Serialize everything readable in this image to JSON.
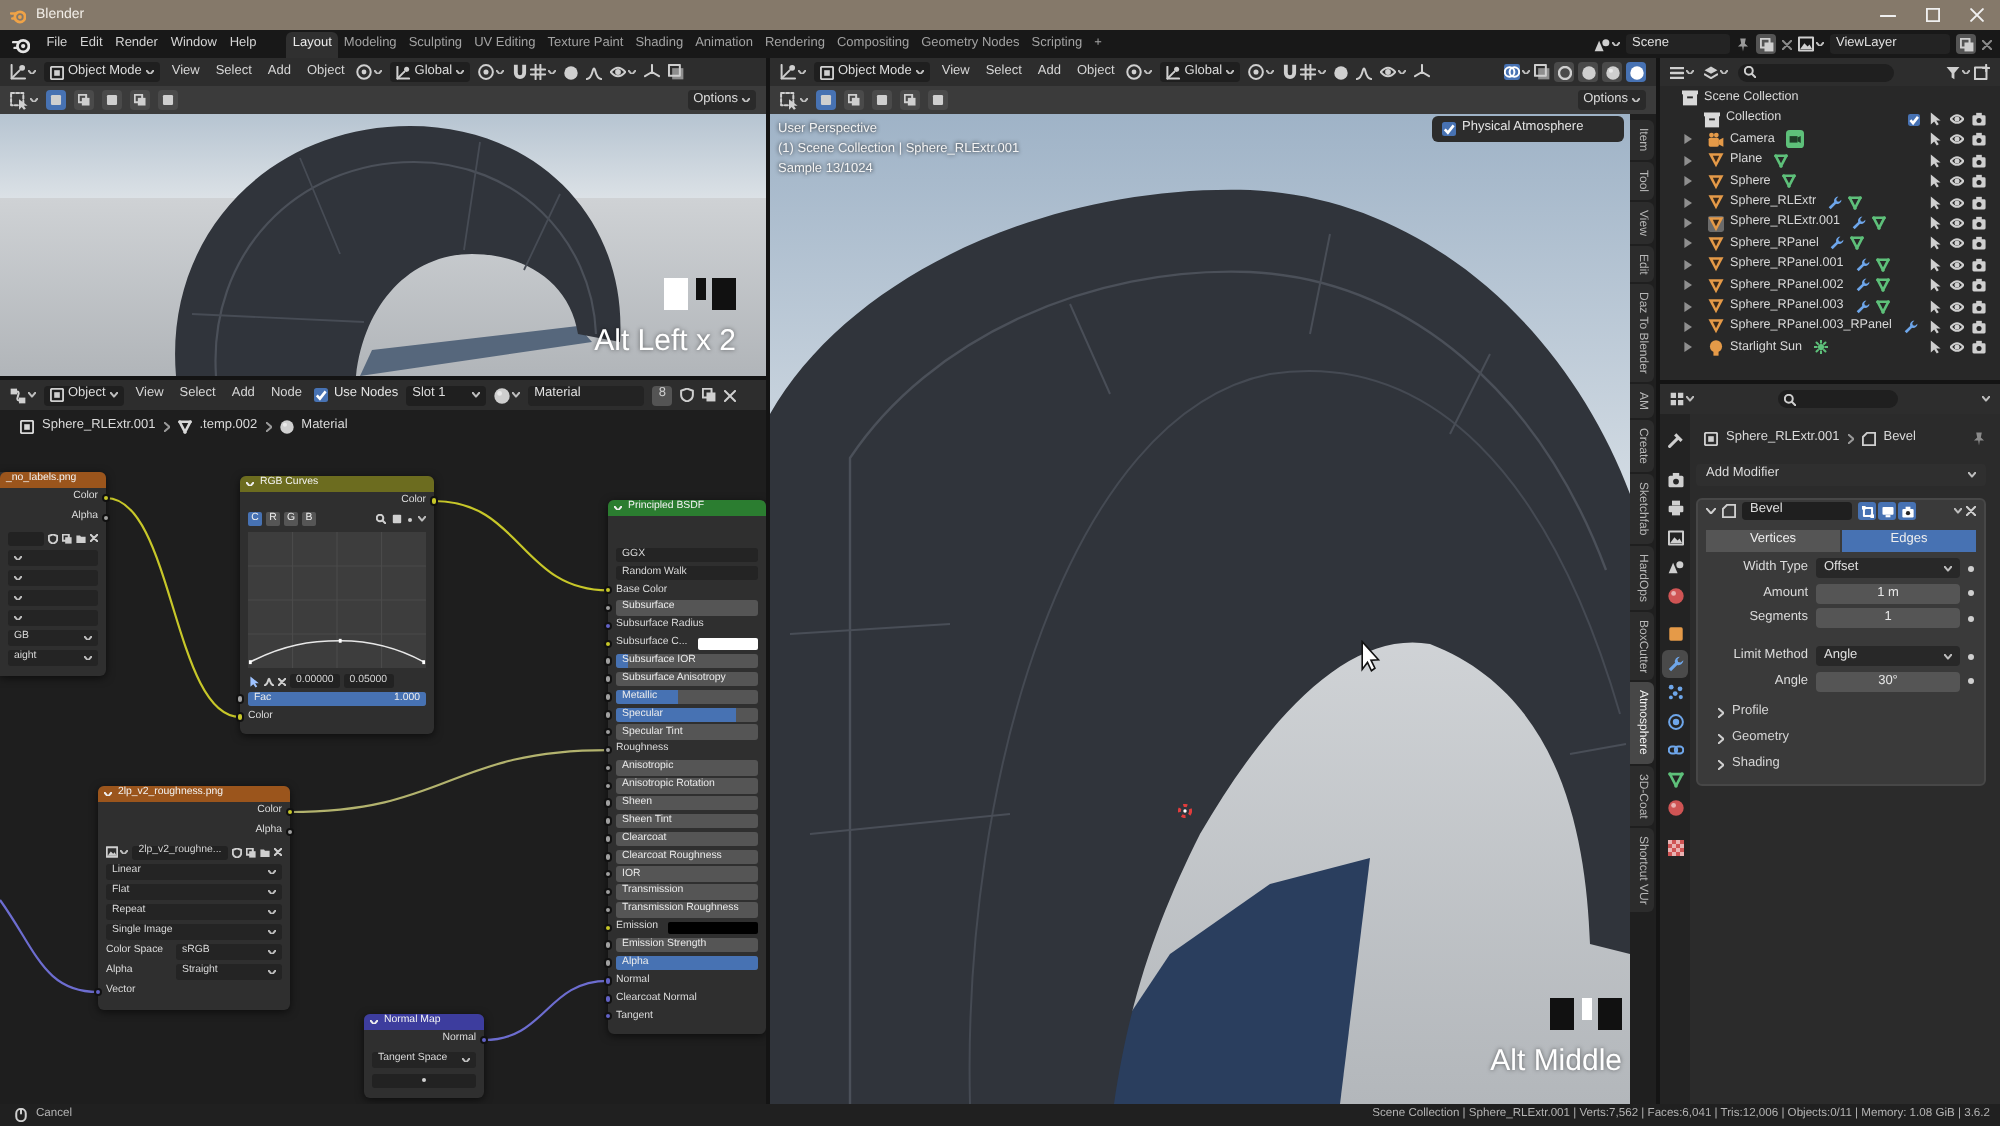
{
  "window": {
    "title": "Blender"
  },
  "topbar": {
    "menus": [
      "File",
      "Edit",
      "Render",
      "Window",
      "Help"
    ],
    "workspaces": [
      {
        "label": "Layout",
        "selected": true
      },
      {
        "label": "Modeling",
        "selected": false
      },
      {
        "label": "Sculpting",
        "selected": false
      },
      {
        "label": "UV Editing",
        "selected": false
      },
      {
        "label": "Texture Paint",
        "selected": false
      },
      {
        "label": "Shading",
        "selected": false
      },
      {
        "label": "Animation",
        "selected": false
      },
      {
        "label": "Rendering",
        "selected": false
      },
      {
        "label": "Compositing",
        "selected": false
      },
      {
        "label": "Geometry Nodes",
        "selected": false
      },
      {
        "label": "Scripting",
        "selected": false
      }
    ],
    "add_workspace": "+",
    "scene": "Scene",
    "view_layer": "ViewLayer"
  },
  "left_viewport": {
    "mode": "Object Mode",
    "menus": [
      "View",
      "Select",
      "Add",
      "Object"
    ],
    "orientation": "Global",
    "select_modes": [
      {
        "selected": true
      },
      {
        "selected": false
      },
      {
        "selected": false
      },
      {
        "selected": false
      },
      {
        "selected": false
      }
    ],
    "options": "Options",
    "key_overlay": {
      "text": "Alt Left x 2",
      "mouse_buttons": [
        {
          "pressed": true
        },
        {
          "pressed": false
        },
        {
          "pressed": false
        }
      ]
    }
  },
  "node_editor": {
    "mode": "Object",
    "menus": [
      "View",
      "Select",
      "Add",
      "Node"
    ],
    "use_nodes": {
      "label": "Use Nodes",
      "checked": true
    },
    "slot": "Slot 1",
    "material": "Material",
    "users": "8",
    "breadcrumb": [
      "Sphere_RLExtr.001",
      ".temp.002",
      "Material"
    ],
    "nodes": [
      {
        "kind": "image_texture",
        "title": "_no_labels.png",
        "color": "#9b551c",
        "rows": [
          {
            "kind": "output",
            "label": "Color",
            "socket": {
              "kind": "color"
            }
          },
          {
            "kind": "output",
            "label": "Alpha",
            "socket": {
              "kind": "float"
            }
          },
          {
            "kind": "image"
          },
          {
            "kind": "dropdown"
          },
          {
            "kind": "dropdown"
          },
          {
            "kind": "dropdown"
          },
          {
            "kind": "dropdown"
          },
          {
            "kind": "dropdown",
            "value": "GB"
          },
          {
            "kind": "dropdown",
            "value": "aight"
          }
        ]
      },
      {
        "kind": "rgb_curves",
        "title": "RGB Curves",
        "color": "#6c6c1f",
        "rows": [
          {
            "kind": "output",
            "label": "Color",
            "socket": {
              "kind": "color"
            }
          },
          {
            "kind": "curve_buttons",
            "buttons": [
              {
                "label": "C",
                "selected": true
              },
              {
                "label": "R",
                "selected": false
              },
              {
                "label": "G",
                "selected": false
              },
              {
                "label": "B",
                "selected": false
              }
            ]
          },
          {
            "kind": "curve"
          },
          {
            "kind": "curve_tools",
            "values": [
              "0.00000",
              "0.05000"
            ]
          },
          {
            "kind": "slider",
            "label": "Fac",
            "value": "1.000",
            "level": 1,
            "socket": {
              "kind": "float"
            }
          },
          {
            "kind": "input",
            "label": "Color",
            "socket": {
              "kind": "color"
            }
          }
        ]
      },
      {
        "kind": "principled",
        "title": "Principled BSDF",
        "color": "#2b7d30",
        "rows": [
          {
            "kind": "dropdown",
            "value": "GGX"
          },
          {
            "kind": "dropdown",
            "value": "Random Walk"
          },
          {
            "kind": "input",
            "label": "Base Color",
            "socket": {
              "kind": "color"
            }
          },
          {
            "kind": "slider",
            "label": "Subsurface",
            "level": 0,
            "socket": {
              "kind": "float"
            }
          },
          {
            "kind": "input",
            "label": "Subsurface Radius",
            "socket": {
              "kind": "vector"
            }
          },
          {
            "kind": "color",
            "label": "Subsurface C...",
            "color": "#ffffff",
            "socket": {
              "kind": "color"
            }
          },
          {
            "kind": "slider",
            "label": "Subsurface IOR",
            "level": 0.09,
            "socket": {
              "kind": "float"
            }
          },
          {
            "kind": "slider",
            "label": "Subsurface Anisotropy",
            "level": 0,
            "socket": {
              "kind": "float"
            }
          },
          {
            "kind": "slider",
            "label": "Metallic",
            "level": 0.43,
            "socket": {
              "kind": "float"
            }
          },
          {
            "kind": "slider",
            "label": "Specular",
            "level": 0.84,
            "socket": {
              "kind": "float"
            }
          },
          {
            "kind": "slider",
            "label": "Specular Tint",
            "level": 0,
            "socket": {
              "kind": "float"
            }
          },
          {
            "kind": "input",
            "label": "Roughness",
            "socket": {
              "kind": "float"
            }
          },
          {
            "kind": "slider",
            "label": "Anisotropic",
            "level": 0,
            "socket": {
              "kind": "float"
            }
          },
          {
            "kind": "slider",
            "label": "Anisotropic Rotation",
            "level": 0,
            "socket": {
              "kind": "float"
            }
          },
          {
            "kind": "slider",
            "label": "Sheen",
            "level": 0,
            "socket": {
              "kind": "float"
            }
          },
          {
            "kind": "slider",
            "label": "Sheen Tint",
            "level": 0,
            "socket": {
              "kind": "float"
            }
          },
          {
            "kind": "slider",
            "label": "Clearcoat",
            "level": 0,
            "socket": {
              "kind": "float"
            }
          },
          {
            "kind": "slider",
            "label": "Clearcoat Roughness",
            "level": 0,
            "socket": {
              "kind": "float"
            }
          },
          {
            "kind": "slider",
            "label": "IOR",
            "level": 0,
            "socket": {
              "kind": "float"
            }
          },
          {
            "kind": "slider",
            "label": "Transmission",
            "level": 0,
            "socket": {
              "kind": "float"
            }
          },
          {
            "kind": "slider",
            "label": "Transmission Roughness",
            "level": 0,
            "socket": {
              "kind": "float"
            }
          },
          {
            "kind": "color",
            "label": "Emission",
            "color": "#000000",
            "socket": {
              "kind": "color"
            }
          },
          {
            "kind": "slider",
            "label": "Emission Strength",
            "level": 0,
            "socket": {
              "kind": "float"
            }
          },
          {
            "kind": "slider",
            "label": "Alpha",
            "level": 1,
            "socket": {
              "kind": "float"
            }
          },
          {
            "kind": "input",
            "label": "Normal",
            "socket": {
              "kind": "vector"
            }
          },
          {
            "kind": "input",
            "label": "Clearcoat Normal",
            "socket": {
              "kind": "vector"
            }
          },
          {
            "kind": "input",
            "label": "Tangent",
            "socket": {
              "kind": "vector"
            }
          }
        ]
      },
      {
        "kind": "image_texture",
        "title": "2lp_v2_roughness.png",
        "color": "#9b551c",
        "rows": [
          {
            "kind": "output",
            "label": "Color",
            "socket": {
              "kind": "color"
            }
          },
          {
            "kind": "output",
            "label": "Alpha",
            "socket": {
              "kind": "float"
            }
          },
          {
            "kind": "image",
            "value": "2lp_v2_roughne..."
          },
          {
            "kind": "dropdown",
            "value": "Linear"
          },
          {
            "kind": "dropdown",
            "value": "Flat"
          },
          {
            "kind": "dropdown",
            "value": "Repeat"
          },
          {
            "kind": "dropdown",
            "value": "Single Image"
          },
          {
            "kind": "dropdown",
            "label": "Color Space",
            "value": "sRGB"
          },
          {
            "kind": "dropdown",
            "label": "Alpha",
            "value": "Straight"
          },
          {
            "kind": "input",
            "label": "Vector",
            "socket": {
              "kind": "vector"
            }
          }
        ]
      },
      {
        "kind": "normal_map",
        "title": "Normal Map",
        "color": "#3d3d9e",
        "rows": [
          {
            "kind": "output",
            "label": "Normal",
            "socket": {
              "kind": "vector"
            }
          },
          {
            "kind": "dropdown",
            "value": "Tangent Space"
          },
          {
            "kind": "field"
          }
        ]
      }
    ]
  },
  "main_viewport": {
    "mode": "Object Mode",
    "menus": [
      "View",
      "Select",
      "Add",
      "Object"
    ],
    "orientation": "Global",
    "shading_modes": [
      {
        "selected": false
      },
      {
        "selected": false
      },
      {
        "selected": false
      },
      {
        "selected": true
      }
    ],
    "select_modes": [
      {
        "selected": true
      },
      {
        "selected": false
      },
      {
        "selected": false
      },
      {
        "selected": false
      },
      {
        "selected": false
      }
    ],
    "options": "Options",
    "info": [
      "User Perspective",
      "(1) Scene Collection | Sphere_RLExtr.001",
      "Sample 13/1024"
    ],
    "physical_atmosphere": {
      "label": "Physical Atmosphere",
      "checked": true
    },
    "key_overlay": {
      "text": "Alt Middle",
      "mouse_buttons": [
        {
          "pressed": false
        },
        {
          "pressed": true
        },
        {
          "pressed": false
        }
      ]
    },
    "sidebar_tabs": [
      {
        "label": "Item",
        "selected": false
      },
      {
        "label": "Tool",
        "selected": false
      },
      {
        "label": "View",
        "selected": false
      },
      {
        "label": "Edit",
        "selected": false
      },
      {
        "label": "Daz To Blender",
        "selected": false
      },
      {
        "label": "AM",
        "selected": false
      },
      {
        "label": "Create",
        "selected": false
      },
      {
        "label": "Sketchfab",
        "selected": false
      },
      {
        "label": "HardOps",
        "selected": false
      },
      {
        "label": "BoxCutter",
        "selected": false
      },
      {
        "label": "Atmosphere",
        "selected": true
      },
      {
        "label": "3D-Coat",
        "selected": false
      },
      {
        "label": "Shortcut VUr",
        "selected": false
      }
    ]
  },
  "outliner": {
    "items": [
      {
        "name": "Scene Collection",
        "kind": "scene",
        "children": [
          {
            "name": "Collection",
            "kind": "collection",
            "checked": true,
            "children": [
              {
                "name": "Camera",
                "kind": "camera",
                "selected": false,
                "expanded": false,
                "has_modifier": false,
                "has_data": true
              },
              {
                "name": "Plane",
                "kind": "mesh",
                "selected": false,
                "expanded": false,
                "has_modifier": false,
                "has_data": true
              },
              {
                "name": "Sphere",
                "kind": "mesh",
                "selected": false,
                "expanded": false,
                "has_modifier": false,
                "has_data": true
              },
              {
                "name": "Sphere_RLExtr",
                "kind": "mesh",
                "selected": false,
                "expanded": false,
                "has_modifier": true,
                "has_data": true
              },
              {
                "name": "Sphere_RLExtr.001",
                "kind": "mesh",
                "selected": true,
                "expanded": false,
                "has_modifier": true,
                "has_data": true
              },
              {
                "name": "Sphere_RPanel",
                "kind": "mesh",
                "selected": false,
                "expanded": false,
                "has_modifier": true,
                "has_data": true
              },
              {
                "name": "Sphere_RPanel.001",
                "kind": "mesh",
                "selected": false,
                "expanded": false,
                "has_modifier": true,
                "has_data": true
              },
              {
                "name": "Sphere_RPanel.002",
                "kind": "mesh",
                "selected": false,
                "expanded": false,
                "has_modifier": true,
                "has_data": true
              },
              {
                "name": "Sphere_RPanel.003",
                "kind": "mesh",
                "selected": false,
                "expanded": false,
                "has_modifier": true,
                "has_data": true
              },
              {
                "name": "Sphere_RPanel.003_RPanel",
                "kind": "mesh",
                "selected": false,
                "expanded": false,
                "has_modifier": true,
                "has_data": false
              },
              {
                "name": "Starlight Sun",
                "kind": "light",
                "selected": false,
                "expanded": false,
                "has_modifier": false,
                "has_data": true
              }
            ]
          }
        ]
      }
    ]
  },
  "properties": {
    "tabs": [
      {
        "kind": "tool",
        "selected": false
      },
      {
        "kind": "render",
        "selected": false
      },
      {
        "kind": "output",
        "selected": false
      },
      {
        "kind": "view_layer",
        "selected": false
      },
      {
        "kind": "scene",
        "selected": false
      },
      {
        "kind": "world",
        "selected": false
      },
      {
        "kind": "object",
        "selected": false
      },
      {
        "kind": "modifier",
        "selected": true
      },
      {
        "kind": "particles",
        "selected": false
      },
      {
        "kind": "physics",
        "selected": false
      },
      {
        "kind": "constraints",
        "selected": false
      },
      {
        "kind": "data",
        "selected": false
      },
      {
        "kind": "material",
        "selected": false
      },
      {
        "kind": "texture",
        "selected": false
      }
    ],
    "breadcrumb": [
      "Sphere_RLExtr.001",
      "Bevel"
    ],
    "add_modifier": "Add Modifier",
    "modifier": {
      "name": "Bevel",
      "expanded": true,
      "toggles": [
        {
          "kind": "edit_mode",
          "on": true
        },
        {
          "kind": "viewport",
          "on": true
        },
        {
          "kind": "render",
          "on": true
        }
      ],
      "affect": [
        {
          "label": "Vertices",
          "selected": false
        },
        {
          "label": "Edges",
          "selected": true
        }
      ],
      "fields": [
        {
          "label": "Width Type",
          "value": "Offset",
          "kind": "dropdown"
        },
        {
          "label": "Amount",
          "value": "1 m",
          "kind": "number"
        },
        {
          "label": "Segments",
          "value": "1",
          "kind": "number"
        },
        {
          "label": "Limit Method",
          "value": "Angle",
          "kind": "dropdown"
        },
        {
          "label": "Angle",
          "value": "30°",
          "kind": "number"
        }
      ],
      "subpanels": [
        {
          "label": "Profile",
          "expanded": false
        },
        {
          "label": "Geometry",
          "expanded": false
        },
        {
          "label": "Shading",
          "expanded": false
        }
      ]
    }
  },
  "status_bar": {
    "left": "Cancel",
    "right": "Scene Collection | Sphere_RLExtr.001 | Verts:7,562 | Faces:6,041 | Tris:12,006 | Objects:0/11 | Memory: 1.08 GiB | 3.6.2"
  }
}
